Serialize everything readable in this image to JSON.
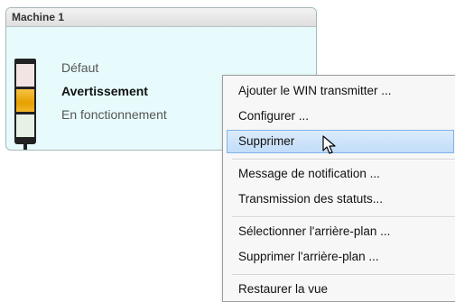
{
  "panel": {
    "title": "Machine 1",
    "statuses": [
      {
        "label": "Défaut",
        "state": "off",
        "color": "#f3e4e4"
      },
      {
        "label": "Avertissement",
        "state": "active",
        "color": "#e6a100"
      },
      {
        "label": "En fonctionnement",
        "state": "off",
        "color": "#e5f2e4"
      }
    ]
  },
  "context_menu": {
    "items": [
      {
        "label": "Ajouter le WIN transmitter ..."
      },
      {
        "label": "Configurer ..."
      },
      {
        "label": "Supprimer",
        "highlighted": true
      },
      {
        "label": "Message de notification ..."
      },
      {
        "label": "Transmission des statuts..."
      },
      {
        "label": "Sélectionner l'arrière-plan ..."
      },
      {
        "label": "Supprimer l'arrière-plan ..."
      },
      {
        "label": "Restaurer la vue"
      }
    ]
  },
  "colors": {
    "panel_bg": "#e7fbfd",
    "highlight": "#c1dcf9",
    "warning": "#e6a100"
  },
  "icons": [
    "signal-tower-icon",
    "mouse-pointer-icon"
  ]
}
